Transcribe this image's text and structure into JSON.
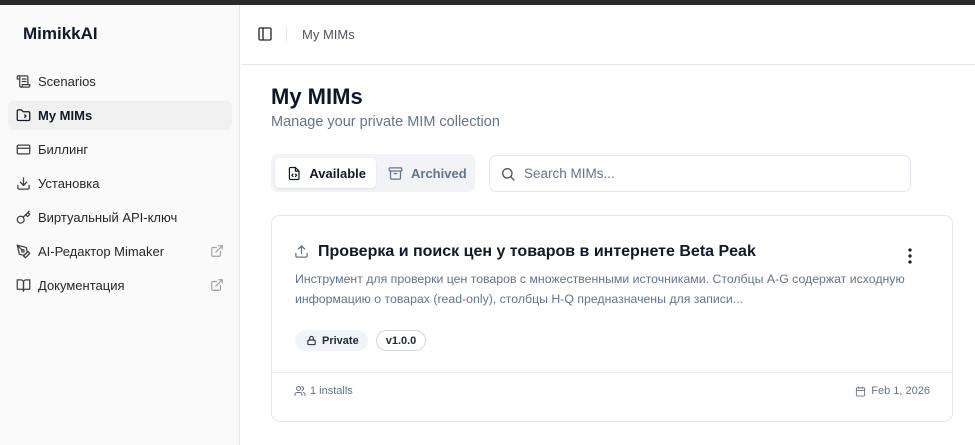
{
  "app": {
    "brand": "MimikkAI"
  },
  "sidebar": {
    "items": [
      {
        "label": "Scenarios",
        "icon": "scroll-icon",
        "active": false,
        "external": false
      },
      {
        "label": "My MIMs",
        "icon": "folder-code-icon",
        "active": true,
        "external": false
      },
      {
        "label": "Биллинг",
        "icon": "credit-card-icon",
        "active": false,
        "external": false
      },
      {
        "label": "Установка",
        "icon": "download-icon",
        "active": false,
        "external": false
      },
      {
        "label": "Виртуальный API-ключ",
        "icon": "key-icon",
        "active": false,
        "external": false
      },
      {
        "label": "AI-Редактор Mimaker",
        "icon": "pen-tool-icon",
        "active": false,
        "external": true
      },
      {
        "label": "Документация",
        "icon": "book-open-icon",
        "active": false,
        "external": true
      }
    ]
  },
  "header": {
    "breadcrumb": "My MIMs",
    "toggle_icon": "sidebar-toggle-icon"
  },
  "main": {
    "title": "My MIMs",
    "subtitle": "Manage your private MIM collection",
    "tabs": [
      {
        "label": "Available",
        "icon": "file-icon",
        "active": true
      },
      {
        "label": "Archived",
        "icon": "archive-icon",
        "active": false
      }
    ],
    "search": {
      "placeholder": "Search MIMs...",
      "value": ""
    },
    "cards": [
      {
        "title": "Проверка и поиск цен у товаров в интернете Beta Peak",
        "description": "Инструмент для проверки цен товаров с множественными источниками. Столбцы A-G содержат исходную информацию о товарах (read-only), столбцы H-Q предназначены для записи...",
        "badges": {
          "visibility": "Private",
          "version": "v1.0.0"
        },
        "installs": "1 installs",
        "date": "Feb 1, 2026"
      }
    ]
  },
  "colors": {
    "text_primary": "#0f172a",
    "text_muted": "#64748b",
    "sidebar_bg": "#fafafa",
    "border": "#e5e7eb",
    "active_nav_bg": "#f0f0f0"
  }
}
